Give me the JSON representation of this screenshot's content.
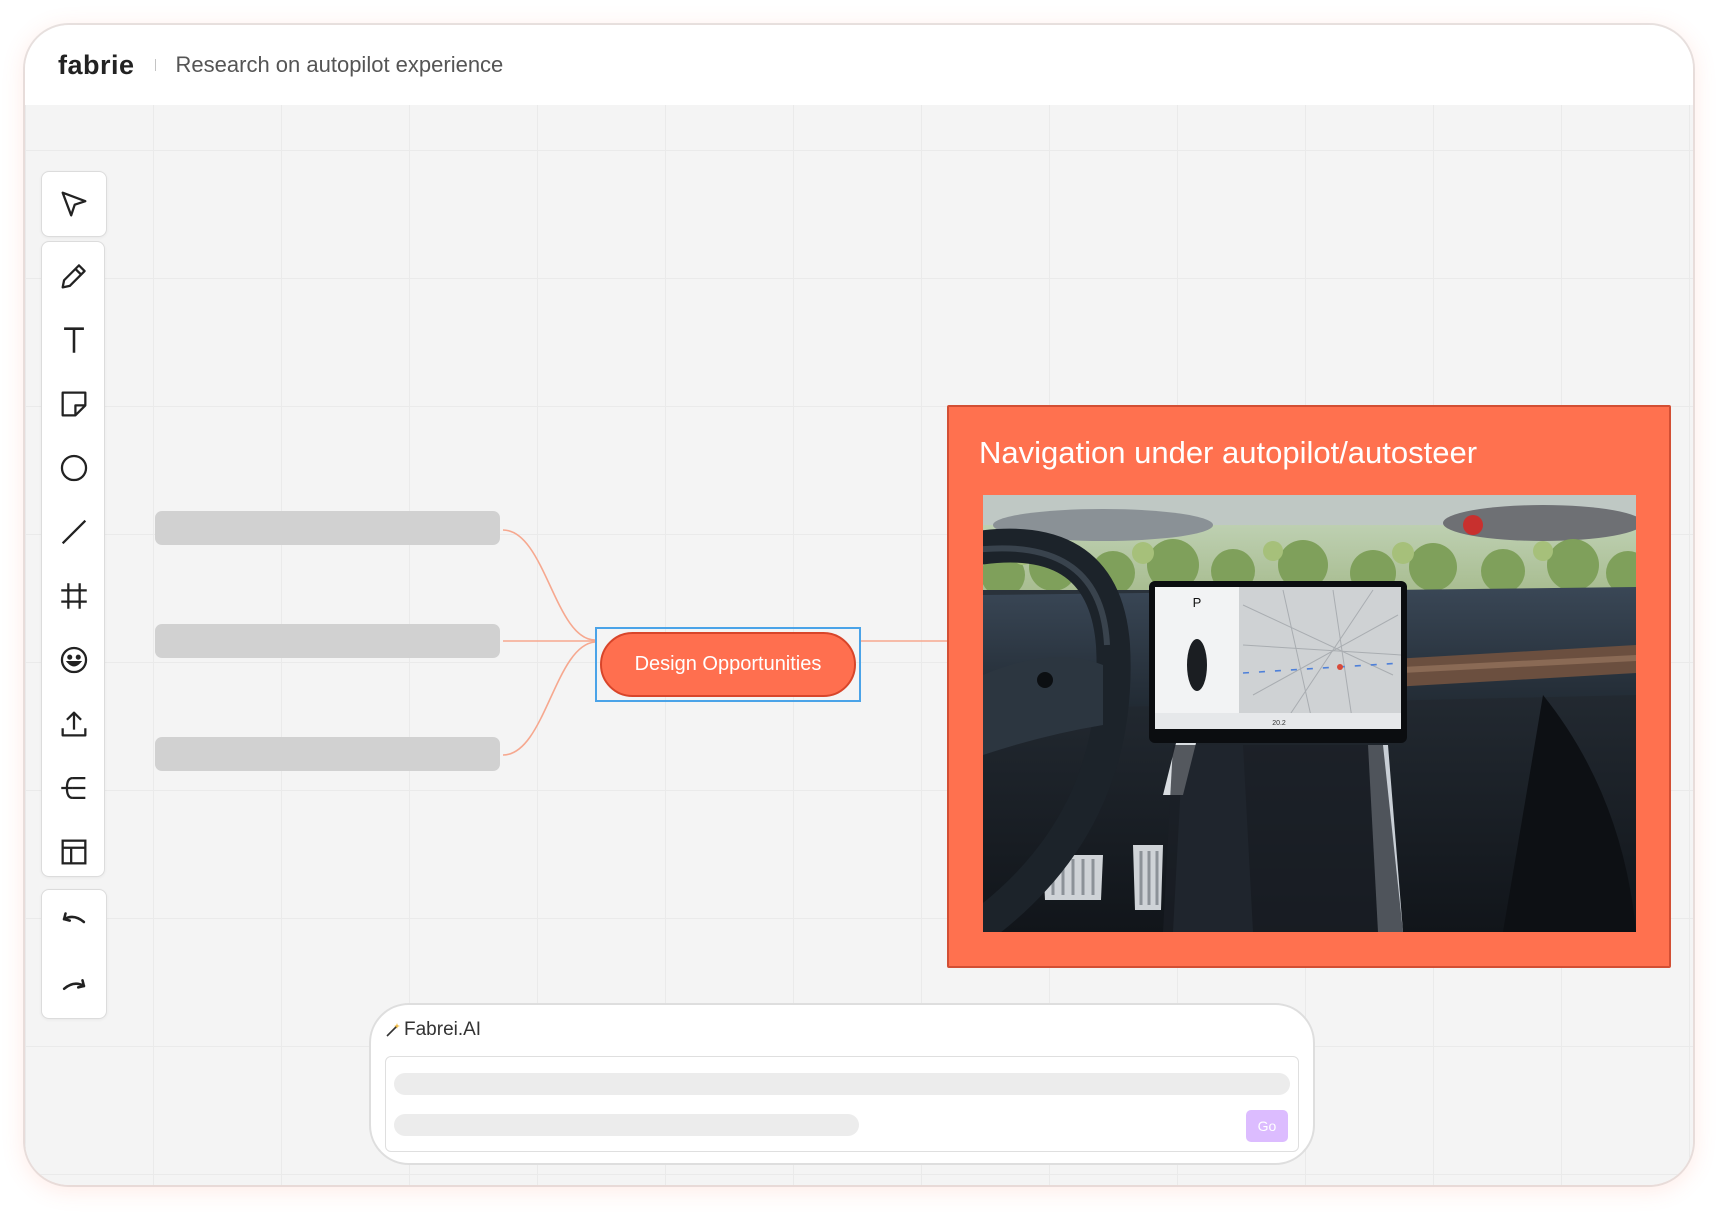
{
  "header": {
    "logo": "fabrie",
    "title": "Research on autopilot experience"
  },
  "toolbar": {
    "groups": [
      [
        "pointer-icon"
      ],
      [
        "pencil-icon",
        "text-icon",
        "sticky-note-icon",
        "circle-icon",
        "line-icon",
        "frame-icon",
        "emoji-icon",
        "upload-icon",
        "mind-map-icon",
        "table-layout-icon"
      ],
      [
        "undo-icon",
        "redo-icon"
      ]
    ]
  },
  "mindmap": {
    "center_label": "Design Opportunities"
  },
  "card": {
    "title": "Navigation under autopilot/autosteer",
    "photo_screen_gear": "P",
    "photo_screen_speed": "20.2"
  },
  "ai": {
    "title": "Fabrei.AI",
    "go_label": "Go"
  },
  "colors": {
    "accent": "#ff6f4f",
    "selection": "#4aa3e8",
    "go_button": "#dcbcff"
  }
}
